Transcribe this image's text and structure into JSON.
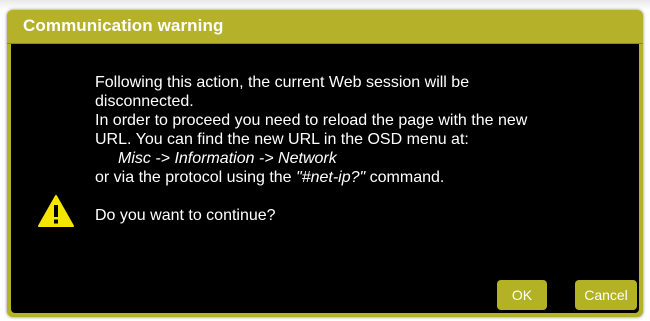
{
  "dialog": {
    "title": "Communication warning",
    "icon": "warning-triangle-icon",
    "message": {
      "line1": "Following this action, the current Web session will be",
      "line2": "disconnected.",
      "line3": "In order to proceed you need to reload the page with the new",
      "line4": "URL. You can find the new URL in the OSD menu at:",
      "menu_path": "Misc -> Information -> Network",
      "protocol_prefix": "or via the protocol using the ",
      "protocol_command": "\"#net-ip?\"",
      "protocol_suffix": " command.",
      "question": "Do you want to continue?"
    },
    "buttons": {
      "ok": "OK",
      "cancel": "Cancel"
    }
  },
  "colors": {
    "accent": "#b3b225",
    "body_background": "#000000",
    "text": "#ffffff",
    "warning_fill": "#f5e600"
  }
}
